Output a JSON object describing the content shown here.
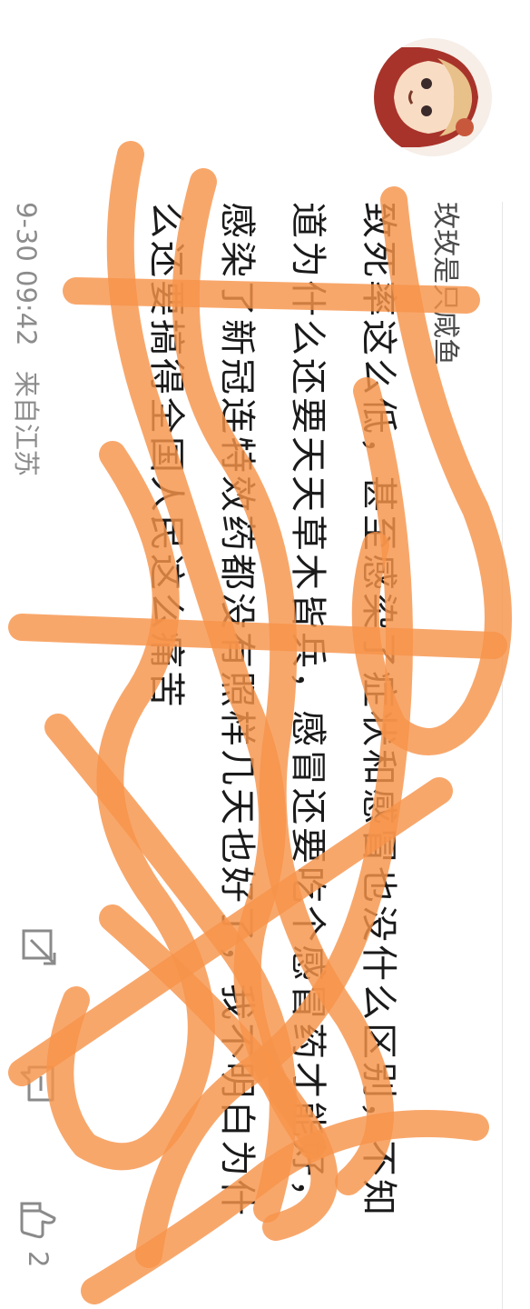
{
  "post": {
    "author": "玫玫是只咸鱼",
    "text": "致死率这么低，甚至感染了症状和感冒也没什么区别，不知道为什么还要天天草木皆兵，感冒还要吃个感冒药才能好，感染了新冠连特效药都没有照样几天也好了，我不明白为什么还要搞得全国人民这么痛苦",
    "timestamp": "9-30 09:42",
    "location": "来自江苏"
  },
  "actions": {
    "like_count": "2"
  },
  "icons": {
    "share": "share-icon",
    "comment": "comment-icon",
    "like": "thumbs-up-icon",
    "avatar": "avatar-image"
  },
  "colors": {
    "scribble": "#f7944a",
    "meta_text": "#8c8c8c",
    "body_text": "#1a1a1a"
  }
}
